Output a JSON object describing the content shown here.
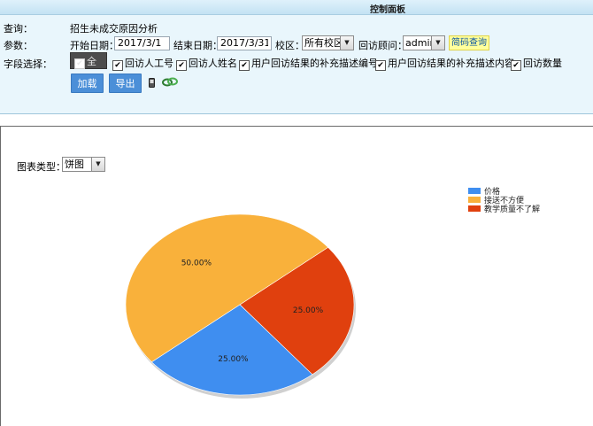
{
  "panel": {
    "title": "控制面板"
  },
  "query": {
    "label": "查询：",
    "value": "招生未成交原因分析"
  },
  "params": {
    "label": "参数：",
    "start_label": "开始日期：",
    "start_value": "2017/3/1",
    "end_label": "结束日期：",
    "end_value": "2017/3/31",
    "campus_label": "校区：",
    "campus_value": "所有校区",
    "advisor_label": "回访顾问：",
    "advisor_value": "admin",
    "quick_query": "简码查询"
  },
  "fields": {
    "label": "字段选择：",
    "select_all": "全选",
    "items": [
      "回访人工号",
      "回访人姓名",
      "用户回访结果的补充描述编号",
      "用户回访结果的补充描述内容",
      "回访数量"
    ]
  },
  "actions": {
    "load": "加载",
    "export": "导出"
  },
  "chart_type": {
    "label": "图表类型：",
    "value": "饼图"
  },
  "colors": {
    "blue": "#3f8ef0",
    "orange": "#f9b13b",
    "red": "#e0400e"
  },
  "chart_data": {
    "type": "pie",
    "categories": [
      "价格",
      "接送不方便",
      "教学质量不了解"
    ],
    "values": [
      25.0,
      50.0,
      25.0
    ],
    "labels": [
      "25.00%",
      "50.00%",
      "25.00%"
    ],
    "legend": "top-right"
  }
}
